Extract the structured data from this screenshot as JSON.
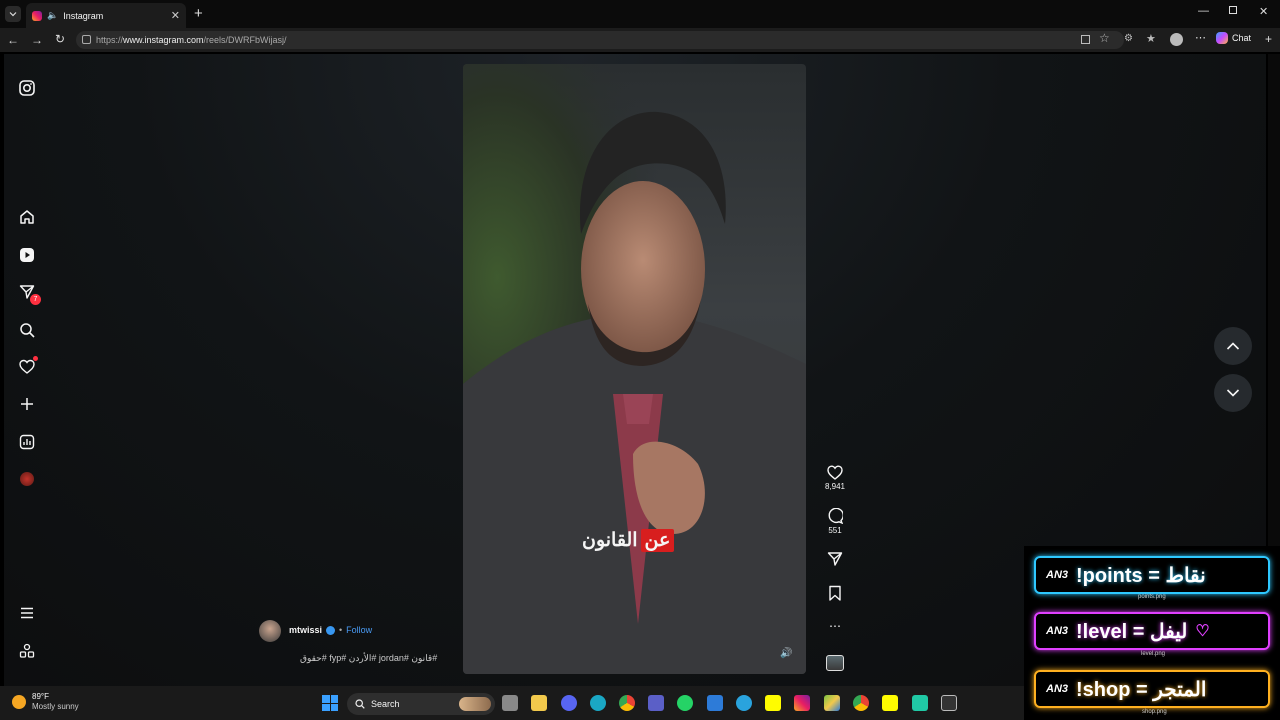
{
  "browser": {
    "tab_title": "Instagram",
    "url_prefix": "https://",
    "url_host": "www.instagram.com",
    "url_path": "/reels/DWRFbWijasj/",
    "chat_label": "Chat"
  },
  "sidebar": {
    "notification_count": "7"
  },
  "reel": {
    "caption_red": "عن",
    "caption_white": "القانون",
    "username": "mtwissi",
    "follow_label": "Follow",
    "hashtags": "#قانون #jordan #الأردن #fyp #حقوق",
    "likes": "8,941",
    "comments": "551"
  },
  "overlay": {
    "rows": [
      {
        "label": "!points = نقاط",
        "file": "points.png",
        "color": "#2ec8ff"
      },
      {
        "label": "!level = ليفل",
        "file": "level.png",
        "color": "#e040ff"
      },
      {
        "label": "!shop = المتجر",
        "file": "shop.png",
        "color": "#ffb020"
      }
    ]
  },
  "taskbar": {
    "temperature": "89°F",
    "weather": "Mostly sunny",
    "search_placeholder": "Search"
  }
}
